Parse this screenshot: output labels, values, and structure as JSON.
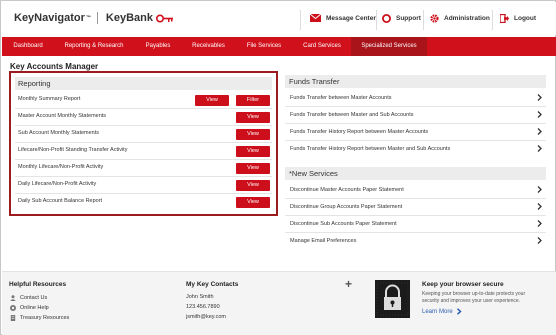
{
  "header": {
    "brand_name": "KeyNavigator",
    "brand_tm": "™",
    "bank_name": "KeyBank",
    "links": [
      {
        "label": "Message Center",
        "icon": "envelope-icon"
      },
      {
        "label": "Support",
        "icon": "lifebuoy-icon"
      },
      {
        "label": "Administration",
        "icon": "gear-icon"
      },
      {
        "label": "Logout",
        "icon": "logout-icon"
      }
    ]
  },
  "nav": {
    "items": [
      {
        "label": "Dashboard"
      },
      {
        "label": "Reporting & Research"
      },
      {
        "label": "Payables"
      },
      {
        "label": "Receivables"
      },
      {
        "label": "File Services"
      },
      {
        "label": "Card Services"
      },
      {
        "label": "Specialized Services",
        "active": true
      }
    ]
  },
  "page": {
    "title": "Key Accounts Manager"
  },
  "reporting": {
    "title": "Reporting",
    "view_label": "View",
    "filter_label": "Filter",
    "rows": [
      {
        "label": "Monthly Summary Report"
      },
      {
        "label": "Master Account Monthly Statements"
      },
      {
        "label": "Sub Account Monthly Statements"
      },
      {
        "label": "Lifecare/Non-Profit Standing Transfer Activity"
      },
      {
        "label": "Monthly Lifecare/Non-Profit Activity"
      },
      {
        "label": "Daily Lifecare/Non-Profit Activity"
      },
      {
        "label": "Daily Sub Account Balance Report"
      }
    ]
  },
  "funds_transfer": {
    "title": "Funds Transfer",
    "rows": [
      {
        "label": "Funds Transfer between Master Accounts"
      },
      {
        "label": "Funds Transfer between Master and Sub Accounts"
      },
      {
        "label": "Funds Transfer History Report between Master Accounts"
      },
      {
        "label": "Funds Transfer History Report between Master and Sub Accounts"
      }
    ]
  },
  "new_services": {
    "title": "*New Services",
    "rows": [
      {
        "label": "Discontinue Master Accounts Paper Statement"
      },
      {
        "label": "Discontinue Group Accounts Paper Statement"
      },
      {
        "label": "Discontinue Sub Accounts Paper Statement"
      },
      {
        "label": "Manage Email Preferences"
      }
    ]
  },
  "footer": {
    "helpful_title": "Helpful Resources",
    "helpful_links": [
      {
        "label": "Contact Us",
        "icon": "person-icon"
      },
      {
        "label": "Online Help",
        "icon": "help-icon"
      },
      {
        "label": "Treasury Resources",
        "icon": "document-icon"
      }
    ],
    "contacts_title": "My Key Contacts",
    "contact_name": "John Smith",
    "contact_phone": "123.456.7890",
    "contact_email": "jsmith@key.com",
    "plus_symbol": "+",
    "secure_title": "Keep your browser secure",
    "secure_text": "Keeping your browser up-to-date protects your security and improves your user experience.",
    "learn_more": "Learn More"
  },
  "colors": {
    "brand_red": "#d0101b",
    "nav_active": "#a8141a",
    "highlight_border": "#9b1b1f",
    "link_blue": "#2a5db0"
  }
}
